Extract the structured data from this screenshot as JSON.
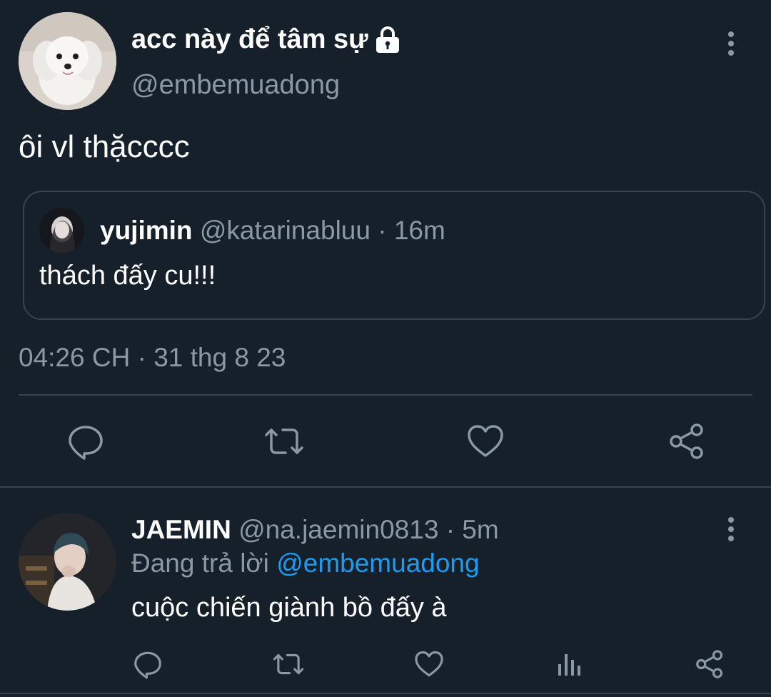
{
  "tweet": {
    "display_name": "acc này để tâm sự",
    "handle": "@embemuadong",
    "text": "ôi vl thặcccc",
    "timestamp": "04:26 CH · 31 thg 8 23",
    "quote": {
      "name": "yujimin",
      "handle": "@katarinabluu",
      "sep": "·",
      "time": "16m",
      "text": "thách đấy cu!!!"
    }
  },
  "reply": {
    "name": "JAEMIN",
    "handle": "@na.jaemin0813",
    "sep": "·",
    "time": "5m",
    "replying_prefix": "Đang trả lời",
    "replying_to": "@embemuadong",
    "text": "cuộc chiến giành bồ đấy à"
  },
  "icons": {
    "lock": "lock-icon",
    "more": "more-vertical-icon",
    "reply": "reply-icon",
    "retweet": "retweet-icon",
    "like": "heart-icon",
    "analytics": "analytics-icon",
    "share": "share-icon"
  },
  "colors": {
    "background": "#15202b",
    "muted_text": "#8b98a5",
    "link": "#1d9bf0",
    "divider": "#38444d"
  }
}
